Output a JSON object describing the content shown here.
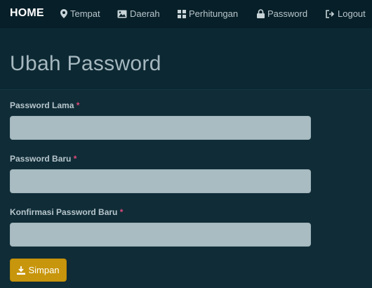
{
  "navbar": {
    "brand": "HOME",
    "items": [
      {
        "label": "Tempat",
        "icon": "map-marker-icon"
      },
      {
        "label": "Daerah",
        "icon": "image-icon"
      },
      {
        "label": "Perhitungan",
        "icon": "grid-icon"
      },
      {
        "label": "Password",
        "icon": "lock-icon"
      },
      {
        "label": "Logout",
        "icon": "logout-icon"
      }
    ]
  },
  "page": {
    "title": "Ubah Password"
  },
  "form": {
    "fields": [
      {
        "label": "Password Lama",
        "required_mark": "*",
        "value": ""
      },
      {
        "label": "Password Baru",
        "required_mark": "*",
        "value": ""
      },
      {
        "label": "Konfirmasi Password Baru",
        "required_mark": "*",
        "value": ""
      }
    ],
    "submit_label": "Simpan",
    "submit_icon": "download-icon"
  },
  "colors": {
    "navbar_bg": "#071f28",
    "page_bg": "#0e2b36",
    "input_bg": "#a9bcc1",
    "required": "#e0497a",
    "button_bg": "#c8960c"
  }
}
